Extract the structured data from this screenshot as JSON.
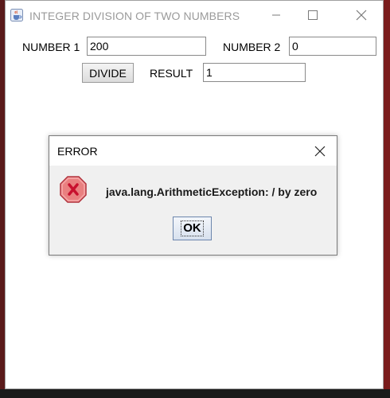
{
  "window": {
    "title": "INTEGER DIVISION OF TWO NUMBERS"
  },
  "form": {
    "number1_label": "NUMBER 1",
    "number1_value": "200",
    "number2_label": "NUMBER 2",
    "number2_value": "0",
    "divide_label": "DIVIDE",
    "result_label": "RESULT",
    "result_value": "1"
  },
  "dialog": {
    "title": "ERROR",
    "message": "java.lang.ArithmeticException: / by zero",
    "ok_label": "OK",
    "icon": "error-icon"
  },
  "colors": {
    "error_red": "#c8102e",
    "error_fill": "#f4a0a0",
    "window_bg": "#ffffff",
    "dialog_bg": "#f0f0f0"
  }
}
